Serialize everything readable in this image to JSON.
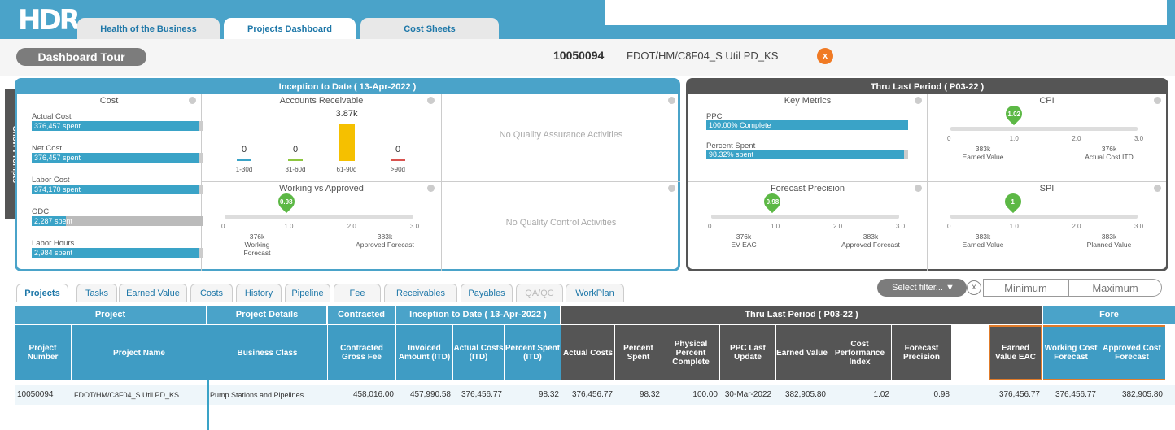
{
  "app": {
    "logo": "HDR"
  },
  "tabs": [
    "Health of the Business",
    "Projects Dashboard",
    "Cost Sheets"
  ],
  "toolbar": {
    "tour_label": "Dashboard Tour",
    "project_number": "10050094",
    "project_name": "FDOT/HM/C8F04_S Util PD_KS",
    "close_label": "x"
  },
  "show_prompts": "Show Prompts",
  "itd": {
    "title": "Inception to Date ( 13-Apr-2022 )",
    "cost": {
      "title": "Cost",
      "items": [
        {
          "label": "Actual Cost",
          "value": "376,457 spent",
          "fill": 0.98
        },
        {
          "label": "Net Cost",
          "value": "376,457 spent",
          "fill": 0.98
        },
        {
          "label": "Labor Cost",
          "value": "374,170 spent",
          "fill": 0.98
        },
        {
          "label": "ODC",
          "value": "2,287 spent",
          "fill": 0.2
        },
        {
          "label": "Labor Hours",
          "value": "2,984 spent",
          "fill": 0.98
        }
      ]
    },
    "ar": {
      "title": "Accounts Receivable",
      "buckets": [
        {
          "label": "1-30d",
          "value": "0",
          "amount": 0,
          "color": "#3aa3c7"
        },
        {
          "label": "31-60d",
          "value": "0",
          "amount": 0,
          "color": "#8dc63f"
        },
        {
          "label": "61-90d",
          "value": "3.87k",
          "amount": 3870,
          "color": "#f5c000"
        },
        {
          "label": ">90d",
          "value": "0",
          "amount": 0,
          "color": "#d9534f"
        }
      ]
    },
    "qa_message": "No Quality Assurance Activities",
    "qc_message": "No Quality Control Activities",
    "wva": {
      "title": "Working vs Approved",
      "value": 0.98,
      "value_label": "0.98",
      "ticks": [
        "0",
        "1.0",
        "2.0",
        "3.0"
      ],
      "left_value": "376k",
      "left_label": "Working Forecast",
      "right_value": "383k",
      "right_label": "Approved Forecast"
    }
  },
  "tlp": {
    "title": "Thru Last Period ( P03-22 )",
    "key_metrics": {
      "title": "Key Metrics",
      "items": [
        {
          "label": "PPC",
          "value": "100.00% Complete",
          "fill": 1.0
        },
        {
          "label": "Percent Spent",
          "value": "98.32% spent",
          "fill": 0.98
        }
      ]
    },
    "cpi": {
      "title": "CPI",
      "value": 1.02,
      "value_label": "1.02",
      "ticks": [
        "0",
        "1.0",
        "2.0",
        "3.0"
      ],
      "left_value": "383k",
      "left_label": "Earned Value",
      "right_value": "376k",
      "right_label": "Actual Cost ITD"
    },
    "fp": {
      "title": "Forecast Precision",
      "value": 0.98,
      "value_label": "0.98",
      "ticks": [
        "0",
        "1.0",
        "2.0",
        "3.0"
      ],
      "left_value": "376k",
      "left_label": "EV EAC",
      "right_value": "383k",
      "right_label": "Approved Forecast"
    },
    "spi": {
      "title": "SPI",
      "value": 1,
      "value_label": "1",
      "ticks": [
        "0",
        "1.0",
        "2.0",
        "3.0"
      ],
      "left_value": "383k",
      "left_label": "Earned Value",
      "right_value": "383k",
      "right_label": "Planned Value"
    }
  },
  "subtabs": [
    "Projects",
    "Tasks",
    "Earned Value",
    "Costs",
    "History",
    "Pipeline",
    "Fee",
    "Receivables",
    "Payables",
    "QA/QC",
    "WorkPlan"
  ],
  "filter": {
    "label": "Select filter...",
    "clear": "x",
    "min_label": "Minimum",
    "max_label": "Maximum"
  },
  "table": {
    "groups": [
      "Project",
      "Project Details",
      "Contracted",
      "Inception to Date ( 13-Apr-2022 )",
      "Thru Last Period ( P03-22 )",
      "Fore"
    ],
    "columns": [
      "Project Number",
      "Project Name",
      "Business Class",
      "Contracted Gross Fee",
      "Invoiced Amount (ITD)",
      "Actual Costs (ITD)",
      "Percent Spent (ITD)",
      "Actual Costs",
      "Percent Spent",
      "Physical Percent Complete",
      "PPC Last Update",
      "Earned Value",
      "Cost Performance Index",
      "Forecast Precision",
      "Earned Value EAC",
      "Working Cost Forecast",
      "Approved Cost Forecast"
    ],
    "row": [
      "10050094",
      "FDOT/HM/C8F04_S Util PD_KS",
      "Pump Stations and Pipelines",
      "458,016.00",
      "457,990.58",
      "376,456.77",
      "98.32",
      "376,456.77",
      "98.32",
      "100.00",
      "30-Mar-2022",
      "382,905.80",
      "1.02",
      "0.98",
      "376,456.77",
      "376,456.77",
      "382,905.80"
    ]
  },
  "colors": {
    "accent": "#4aa3c9",
    "dark": "#555555",
    "orange": "#f07a24",
    "green": "#5cb845"
  }
}
